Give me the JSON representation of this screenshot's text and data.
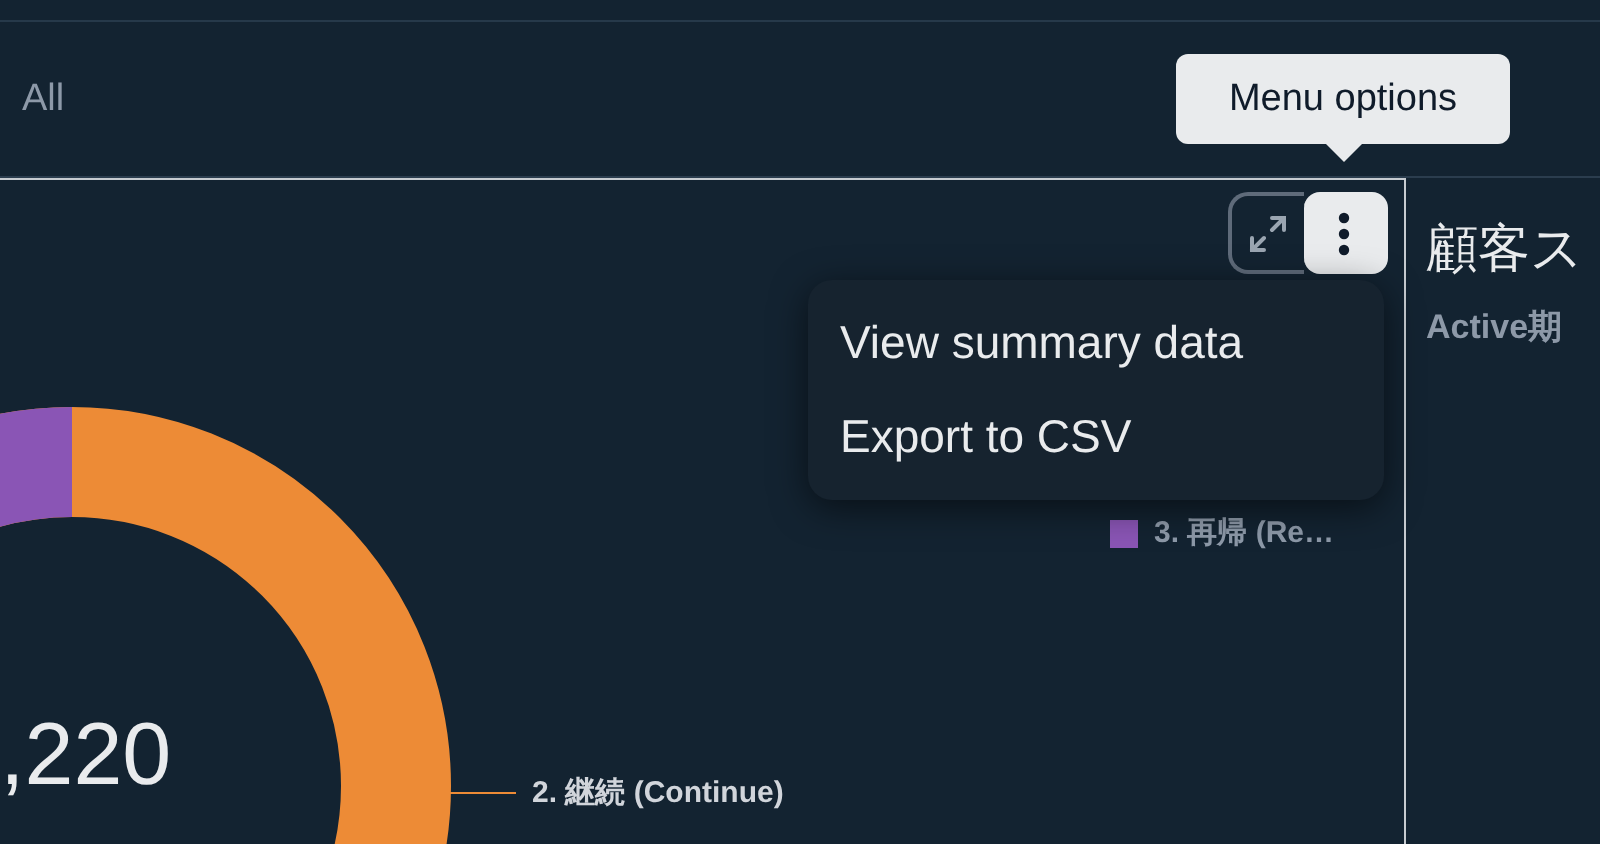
{
  "tabs": [
    {
      "label": "All",
      "selected": false
    }
  ],
  "tooltip": {
    "text": "Menu options"
  },
  "toolbar": {
    "expand_button": {
      "pressed": false
    },
    "menu_button": {
      "expanded": true
    }
  },
  "menu": {
    "items": [
      "View summary data",
      "Export to CSV"
    ]
  },
  "chart": {
    "total": ",220",
    "slice_label": {
      "text": "2. 継続 (Continue)",
      "color": "#ed8b36"
    },
    "legend": [
      {
        "label": "3. 再帰 (Re…",
        "color": "#8a55b5"
      }
    ]
  },
  "side_panel": {
    "title": "顧客ス",
    "subtitle": "Active期"
  }
}
